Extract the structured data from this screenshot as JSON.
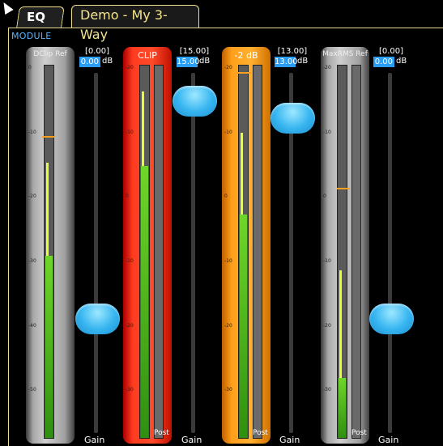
{
  "tabs": {
    "eq": "EQ",
    "active": "Demo - My 3-Way"
  },
  "module_label": "MODULE",
  "meters": [
    {
      "title": "DClip Ref",
      "style": "gray",
      "ticks": [
        "0",
        "-10",
        "-20",
        "-30",
        "-40",
        "-50"
      ],
      "fill_pct": 0.49,
      "peak_pct": 0.74,
      "marker_pct": 0.81,
      "post": ""
    },
    {
      "title": "CLIP",
      "style": "red",
      "ticks": [
        "-20",
        "-10",
        "0",
        "-10",
        "-20",
        "-30"
      ],
      "fill_pct": 0.73,
      "peak_pct": 0.93,
      "marker_pct": 0.0,
      "post": "Post"
    },
    {
      "title": "-2 dB",
      "style": "orange",
      "ticks": [
        "-20",
        "-10",
        "0",
        "-10",
        "-20",
        "-30"
      ],
      "fill_pct": 0.6,
      "peak_pct": 0.82,
      "marker_pct": 0.98,
      "post": "Post"
    },
    {
      "title": "MaxRMS Ref",
      "style": "gray",
      "ticks": [
        "-20",
        "-10",
        "0",
        "-10",
        "-20",
        "-30"
      ],
      "fill_pct": 0.16,
      "peak_pct": 0.45,
      "marker_pct": 0.67,
      "post": "Post"
    }
  ],
  "faders": [
    {
      "bracket": "[0.00]",
      "value": "0.00",
      "unit": "dB",
      "level_pct": 0.3,
      "gain": "Gain"
    },
    {
      "bracket": "[15.00]",
      "value": "15.00",
      "unit": "dB",
      "level_pct": 0.96,
      "gain": "Gain"
    },
    {
      "bracket": "[13.00]",
      "value": "13.00",
      "unit": "dB",
      "level_pct": 0.91,
      "gain": "Gain"
    },
    {
      "bracket": "[0.00]",
      "value": "0.00",
      "unit": "dB",
      "level_pct": 0.3,
      "gain": "Gain"
    }
  ]
}
